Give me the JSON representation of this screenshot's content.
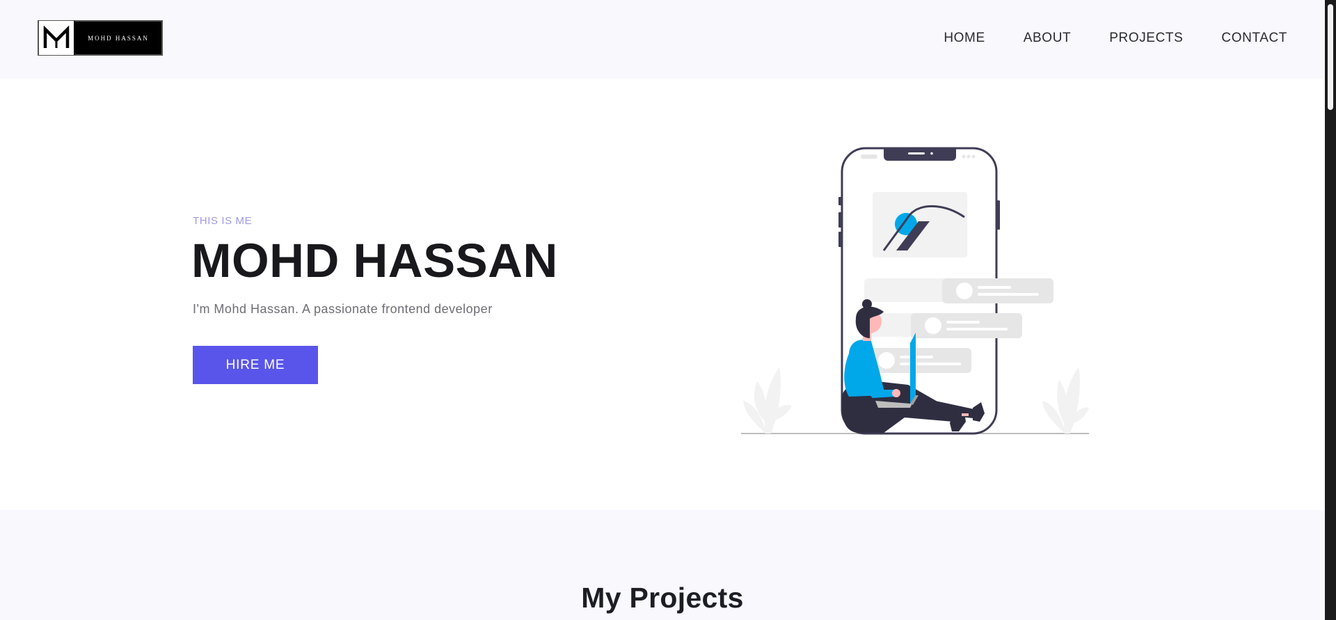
{
  "header": {
    "logo_text": "MOHD HASSAN",
    "nav": [
      {
        "label": "HOME"
      },
      {
        "label": "ABOUT"
      },
      {
        "label": "PROJECTS"
      },
      {
        "label": "CONTACT"
      }
    ]
  },
  "hero": {
    "eyebrow": "THIS IS ME",
    "title": "MOHD HASSAN",
    "subtitle": "I'm Mohd Hassan. A passionate frontend developer",
    "cta_label": "HIRE ME",
    "illustration_icon": "woman-with-laptop-phone-illustration"
  },
  "projects": {
    "title": "My Projects"
  },
  "colors": {
    "accent": "#5a55ea",
    "eyebrow": "#9e9ae8",
    "illustration_blue": "#00a8ea",
    "header_bg": "#f8f8fd"
  }
}
